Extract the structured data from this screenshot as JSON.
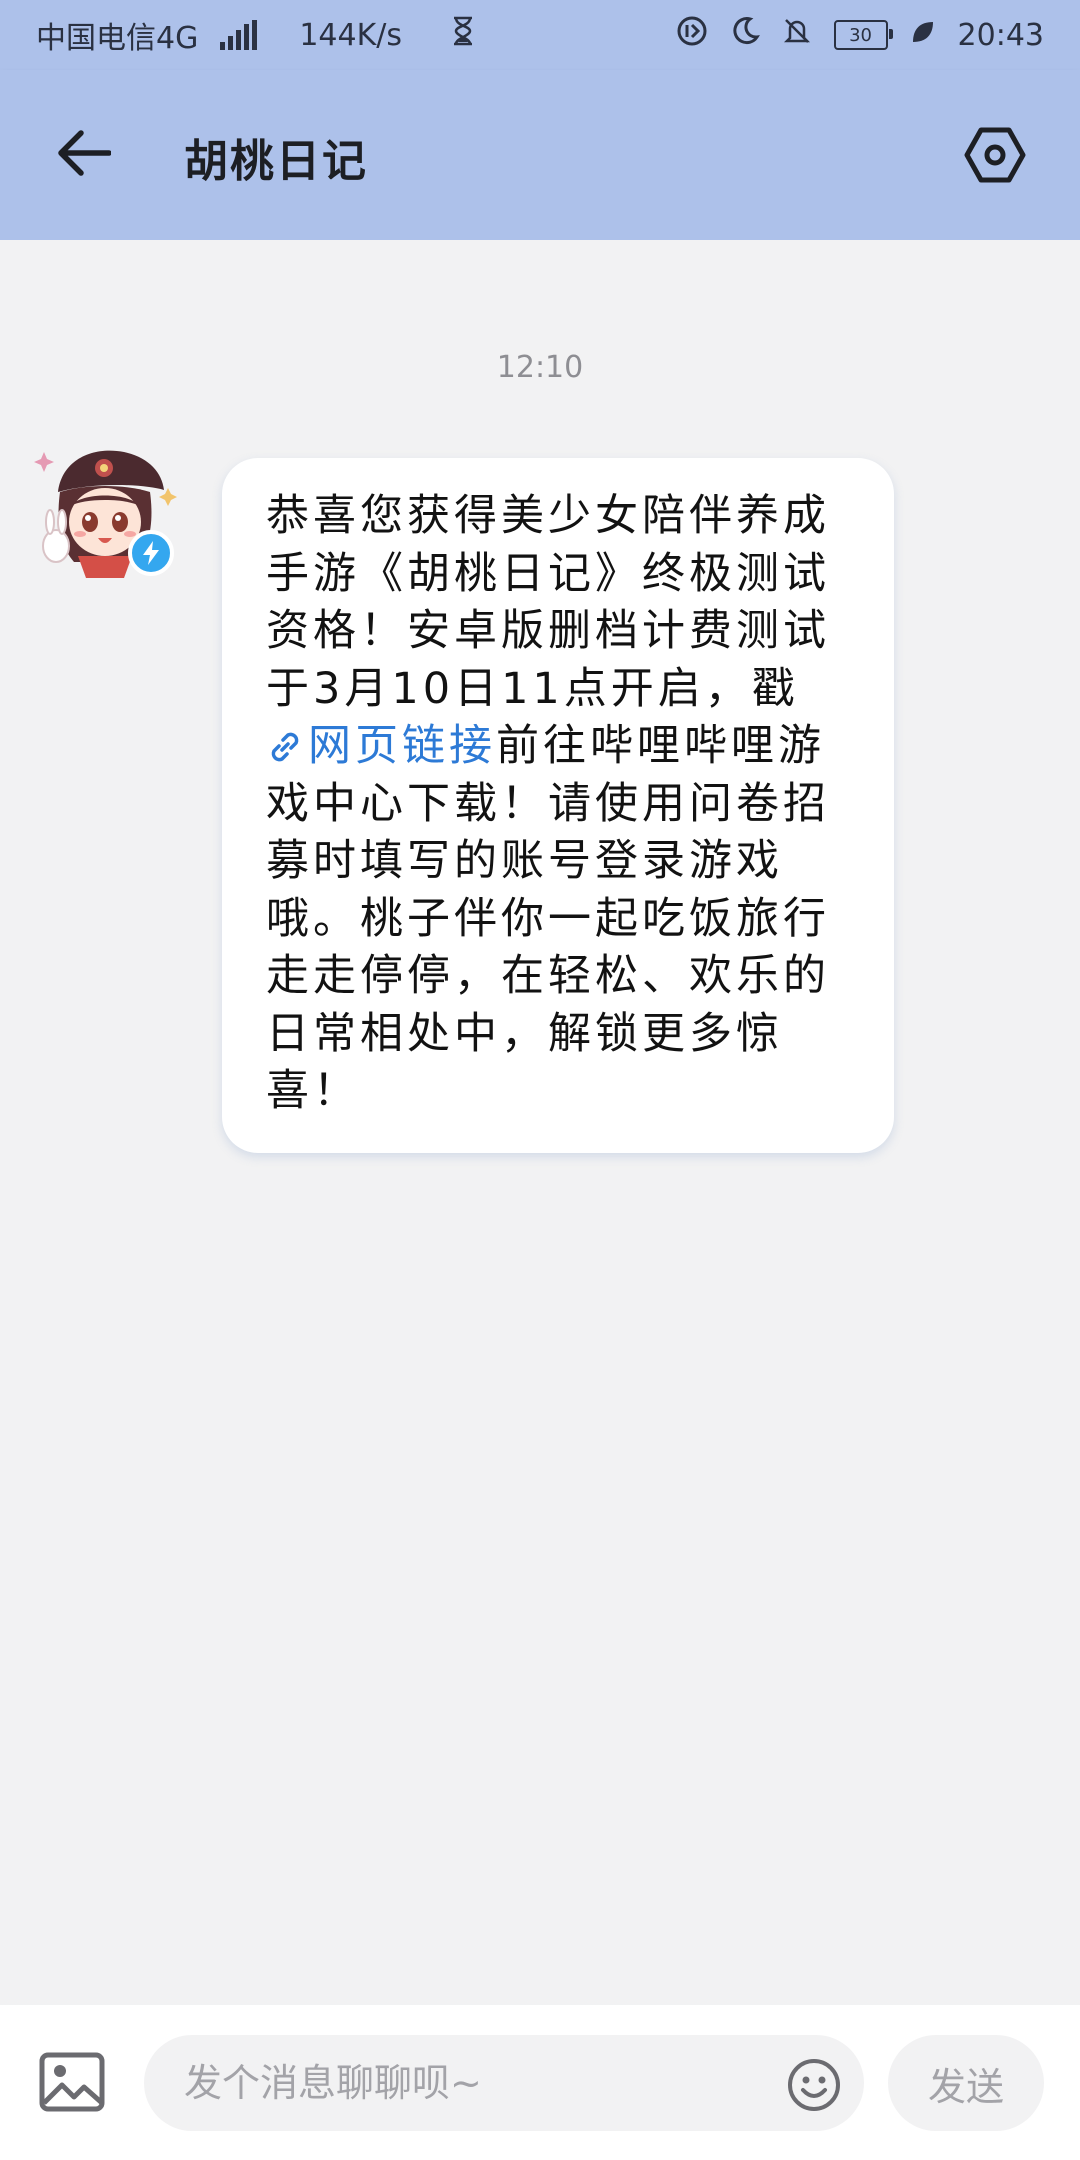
{
  "status_bar": {
    "carrier": "中国电信4G",
    "network_type": "4G",
    "speed": "144K/s",
    "battery": "30",
    "time": "20:43",
    "icons": [
      "signal-icon",
      "hourglass-icon",
      "data-saver-icon",
      "moon-icon",
      "mute-icon",
      "battery-icon",
      "leaf-icon"
    ]
  },
  "header": {
    "title": "胡桃日记",
    "back_icon": "arrow-left-icon",
    "settings_icon": "hexagon-settings-icon"
  },
  "chat": {
    "timestamp": "12:10",
    "message": {
      "text_before": "恭喜您获得美少女陪伴养成手游《胡桃日记》终极测试资格！安卓版删档计费测试于3月10日11点开启，戳",
      "link_text": "网页链接",
      "text_after": "前往哔哩哔哩游戏中心下载！请使用问卷招募时填写的账号登录游戏哦。桃子伴你一起吃饭旅行走走停停，在轻松、欢乐的日常相处中，解锁更多惊喜！"
    },
    "sender_badge_icon": "lightning-icon"
  },
  "input_bar": {
    "placeholder": "发个消息聊聊呗~",
    "send_label": "发送",
    "image_icon": "image-icon",
    "emoji_icon": "emoji-icon"
  },
  "colors": {
    "header_bg": "#adc1ea",
    "chat_bg": "#f2f2f3",
    "link": "#2d7ad6",
    "badge": "#34a7ef"
  }
}
